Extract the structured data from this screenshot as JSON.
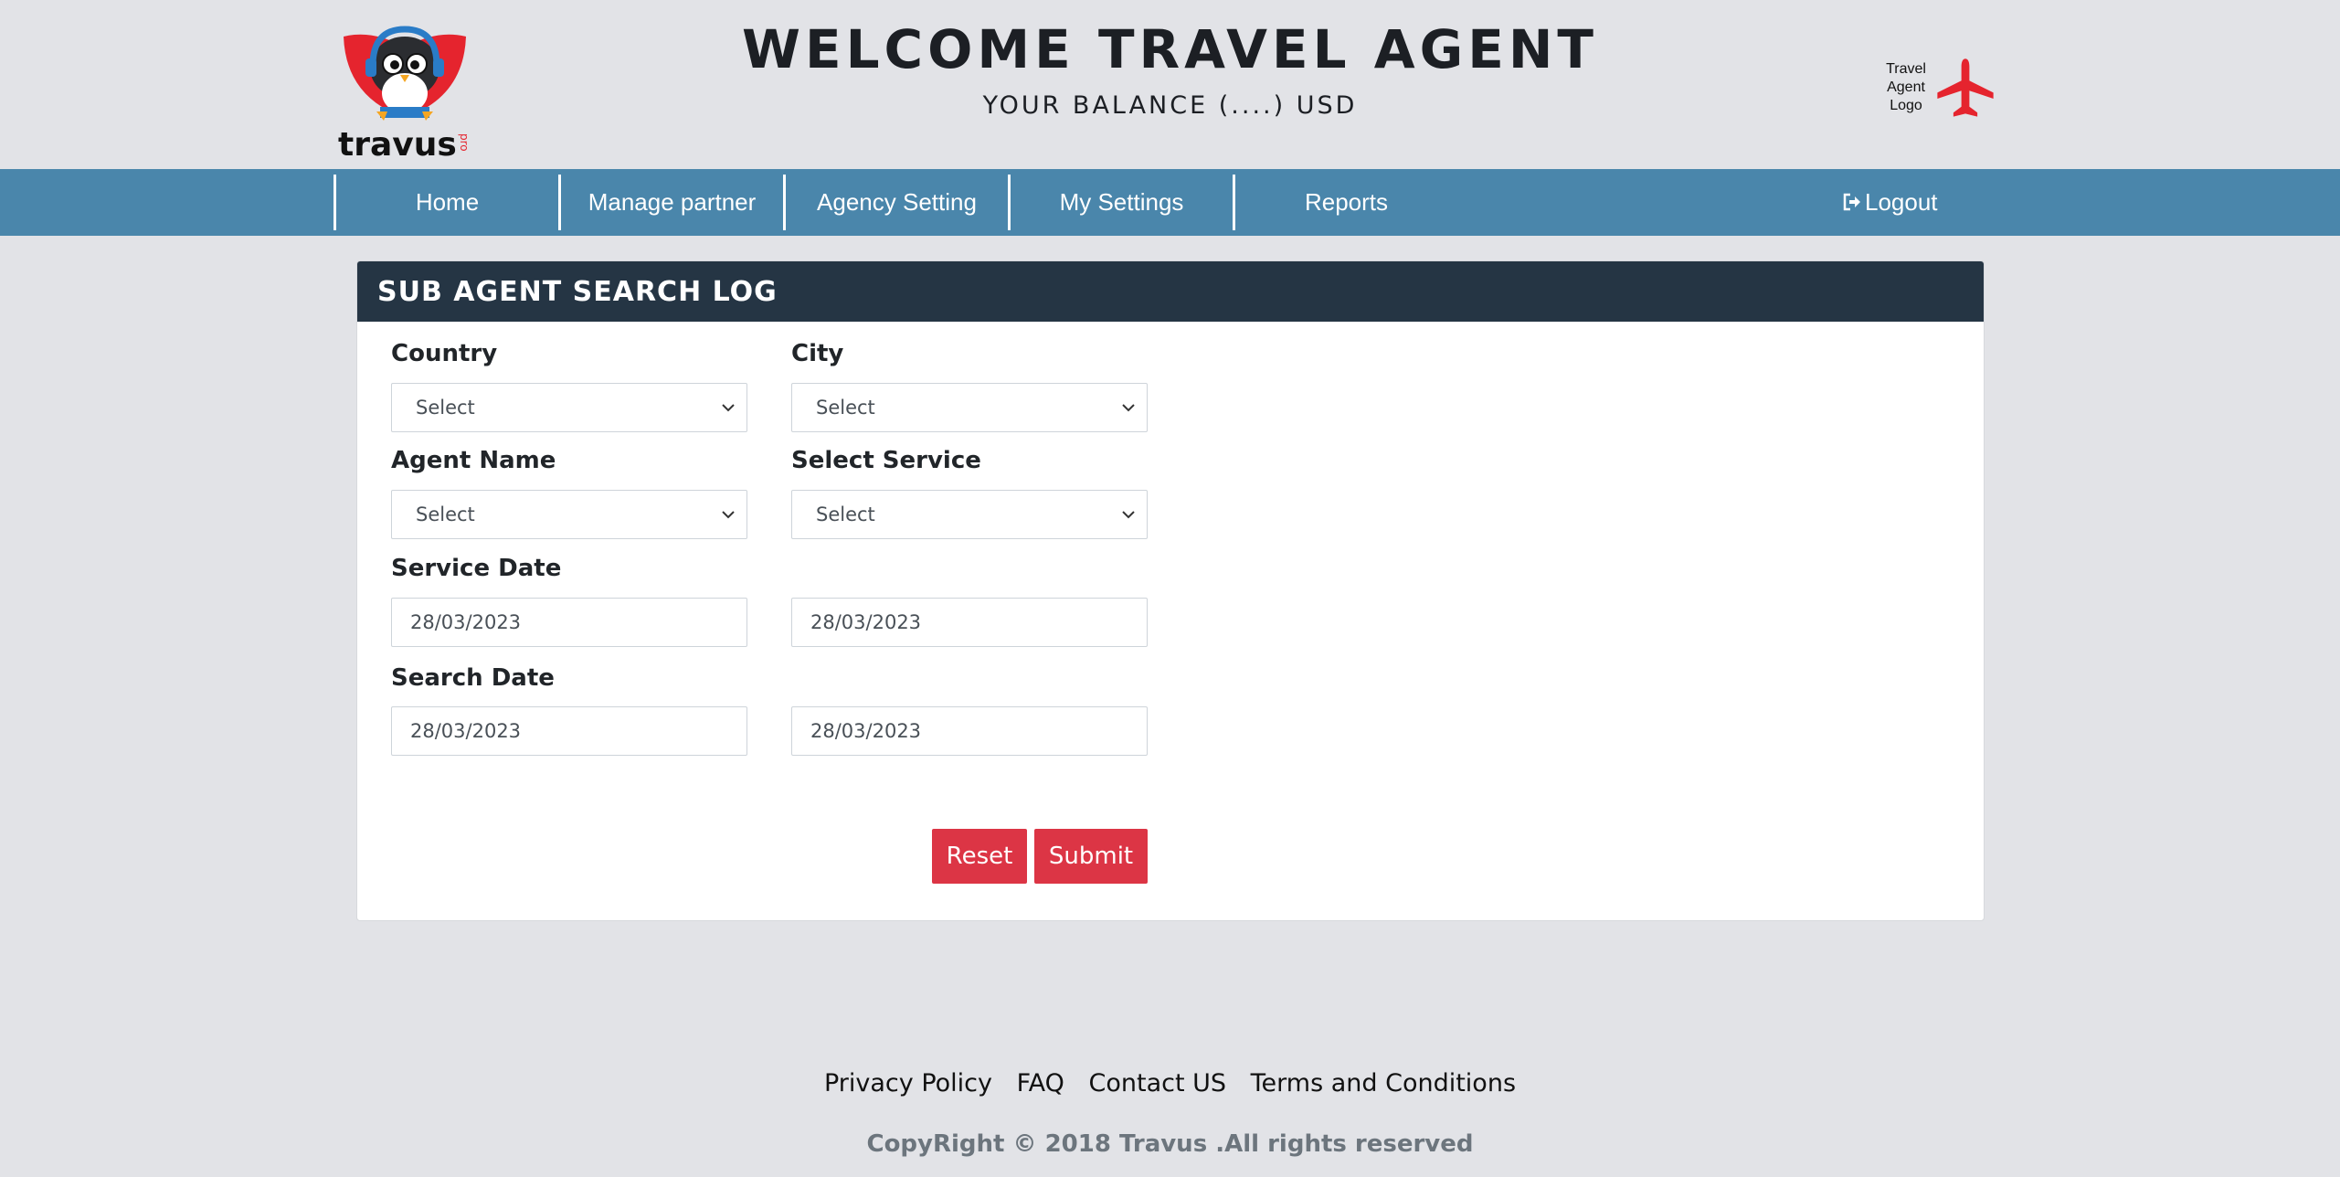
{
  "header": {
    "logo_text": "travus",
    "logo_subtext": "pro",
    "welcome": "WELCOME TRAVEL AGENT",
    "balance": "YOUR BALANCE (....) USD",
    "agent_logo_text": "Travel Agent Logo",
    "plane_color": "#e5242e"
  },
  "nav": {
    "items": [
      {
        "label": "Home"
      },
      {
        "label": "Manage partner"
      },
      {
        "label": "Agency Setting"
      },
      {
        "label": "My Settings"
      },
      {
        "label": "Reports"
      }
    ],
    "logout": "Logout",
    "bg_color": "#4a86ab"
  },
  "panel": {
    "title": "SUB AGENT SEARCH LOG",
    "country": {
      "label": "Country",
      "value": "Select"
    },
    "city": {
      "label": "City",
      "value": "Select"
    },
    "agent_name": {
      "label": "Agent Name",
      "value": "Select"
    },
    "select_service": {
      "label": "Select Service",
      "value": "Select"
    },
    "service_date": {
      "label": "Service Date",
      "from": "28/03/2023",
      "to": "28/03/2023"
    },
    "search_date": {
      "label": "Search Date",
      "from": "28/03/2023",
      "to": "28/03/2023"
    },
    "reset": "Reset",
    "submit": "Submit",
    "button_color": "#dc3545"
  },
  "footer": {
    "links": [
      "Privacy Policy",
      "FAQ",
      "Contact US",
      "Terms and Conditions"
    ],
    "copyright": "CopyRight © 2018 Travus .All rights reserved"
  }
}
